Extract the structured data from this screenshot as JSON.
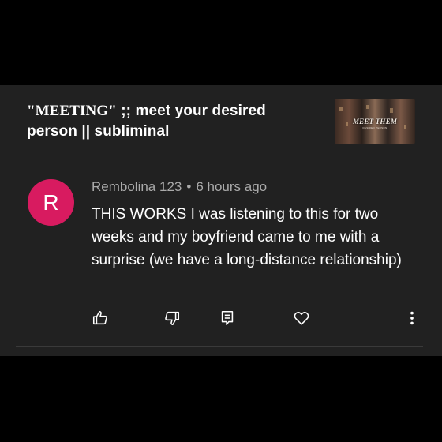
{
  "video": {
    "title_part1": "\"MEETING\"",
    "title_part2": " ;; meet your desired person || subliminal",
    "thumbnail_text": "MEET THEM",
    "thumbnail_subtext": "DESIRED PERSON"
  },
  "comment": {
    "avatar_letter": "R",
    "avatar_color": "#d81b60",
    "author": "Rembolina 123",
    "separator": "•",
    "time": "6 hours ago",
    "text": "THIS WORKS I was listening to this for two weeks and my boyfriend came to me with a surprise (we have a long-distance relationship)"
  },
  "actions": {
    "like_icon": "thumbs-up-icon",
    "dislike_icon": "thumbs-down-icon",
    "reply_icon": "reply-icon",
    "heart_icon": "heart-icon",
    "more_icon": "more-vertical-icon"
  }
}
